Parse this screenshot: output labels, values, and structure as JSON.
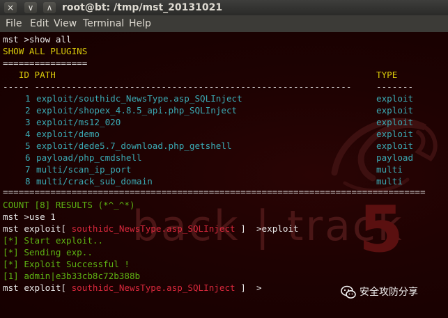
{
  "window": {
    "title": "root@bt: /tmp/mst_20131021",
    "controls": [
      "×",
      "∨",
      "∧"
    ]
  },
  "menu": [
    "File",
    "Edit",
    "View",
    "Terminal",
    "Help"
  ],
  "terminal": {
    "prompt1": "mst >show all",
    "header": "SHOW ALL PLUGINS",
    "sep1": "================",
    "col_id_path": "   ID PATH",
    "col_type": "TYPE",
    "dash_left": "----- ------------------------------------------------------------",
    "dash_right": "-------",
    "plugins": [
      {
        "id": "1",
        "path": "exploit/southidc_NewsType.asp_SQLInject",
        "type": "exploit"
      },
      {
        "id": "2",
        "path": "exploit/shopex_4.8.5_api.php_SQLInject",
        "type": "exploit"
      },
      {
        "id": "3",
        "path": "exploit/ms12_020",
        "type": "exploit"
      },
      {
        "id": "4",
        "path": "exploit/demo",
        "type": "exploit"
      },
      {
        "id": "5",
        "path": "exploit/dede5.7_download.php_getshell",
        "type": "exploit"
      },
      {
        "id": "6",
        "path": "payload/php_cmdshell",
        "type": "payload"
      },
      {
        "id": "7",
        "path": "multi/scan_ip_port",
        "type": "multi"
      },
      {
        "id": "8",
        "path": "multi/crack_sub_domain",
        "type": "multi"
      }
    ],
    "sep2": "================================================================================",
    "count": "COUNT [8] RESULTS (*^_^*)",
    "use_cmd": "mst >use 1",
    "prompt_prefix": "mst exploit[ ",
    "module": "southidc_NewsType.asp_SQLInject",
    "prompt_suffix1": " ]  >exploit",
    "prompt_suffix2": " ]  >",
    "log": [
      {
        "text": "[*] Start exploit..",
        "color": "#5eb313"
      },
      {
        "text": "[*] Sending exp..",
        "color": "#5eb313"
      },
      {
        "text": "[*] Exploit Successful !",
        "color": "#5eb313"
      },
      {
        "text": "[1] admin|e3b33cb8c72b388b",
        "color": "#5eb313"
      }
    ]
  },
  "watermark": {
    "brand": "back | track",
    "version": "5",
    "wechat": "安全攻防分享"
  }
}
